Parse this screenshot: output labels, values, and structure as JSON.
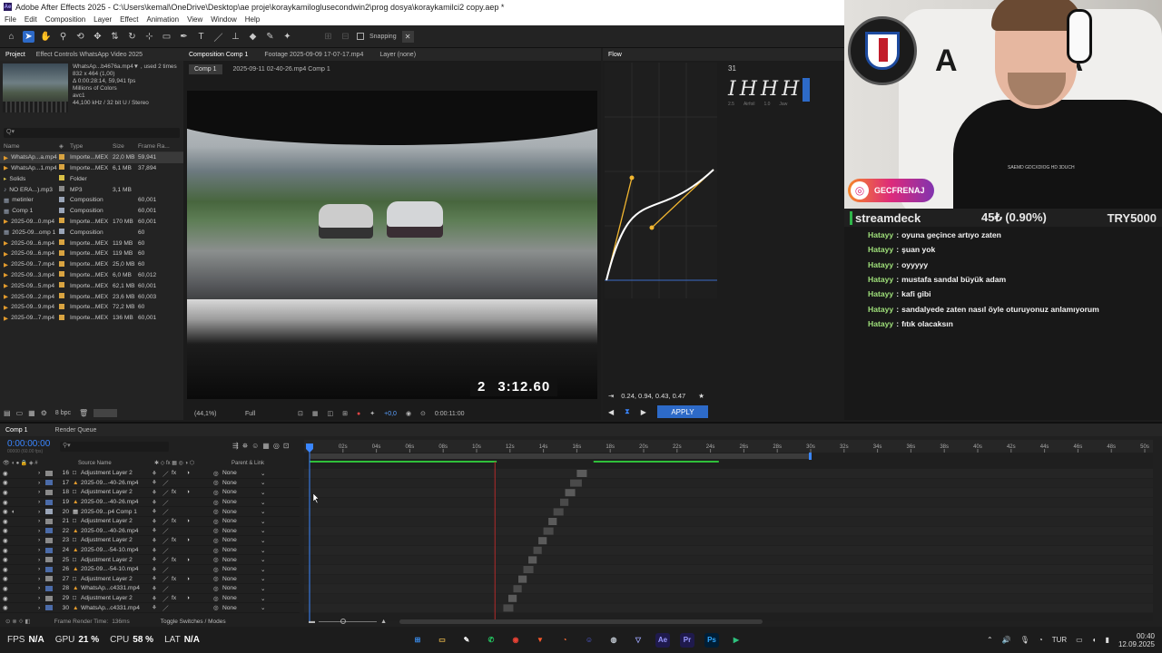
{
  "app": {
    "window_title": "Adobe After Effects 2025 - C:\\Users\\kemal\\OneDrive\\Desktop\\ae proje\\koraykamiloglusecondwin2\\prog dosya\\koraykamilci2 copy.aep *",
    "menu": [
      "File",
      "Edit",
      "Composition",
      "Layer",
      "Effect",
      "Animation",
      "View",
      "Window",
      "Help"
    ],
    "toolbar": {
      "snapping_label": "Snapping"
    }
  },
  "project_panel": {
    "tabs": [
      "Project",
      "Effect Controls WhatsApp Video 2025"
    ],
    "preview_info": [
      "WhatsAp...b4676a.mp4▼ , used 2 times",
      "832 x 464 (1,00)",
      "Δ 0:00:28:14, 59,941 fps",
      "Millions of Colors",
      "avc1",
      "44,100 kHz / 32 bit U / Stereo"
    ],
    "search_placeholder": "Q▾",
    "columns": [
      "Name",
      "Type",
      "Size",
      "Frame Ra..."
    ],
    "items": [
      {
        "name": "WhatsAp...a.mp4",
        "type": "Importe...MEX",
        "size": "22,0 MB",
        "fr": "59,941",
        "color": "#d9a441",
        "icon": "video",
        "selected": true
      },
      {
        "name": "WhatsAp...1.mp4",
        "type": "Importe...MEX",
        "size": "6,1 MB",
        "fr": "37,894",
        "color": "#d9a441",
        "icon": "video"
      },
      {
        "name": "Solids",
        "type": "Folder",
        "size": "",
        "fr": "",
        "color": "#d9c046",
        "icon": "folder"
      },
      {
        "name": "NO ERA...).mp3",
        "type": "MP3",
        "size": "3,1 MB",
        "fr": "",
        "color": "#8a8a8a",
        "icon": "audio"
      },
      {
        "name": "metinler",
        "type": "Composition",
        "size": "",
        "fr": "60,001",
        "color": "#9aa5b8",
        "icon": "comp"
      },
      {
        "name": "Comp 1",
        "type": "Composition",
        "size": "",
        "fr": "60,001",
        "color": "#9aa5b8",
        "icon": "comp"
      },
      {
        "name": "2025-09...0.mp4",
        "type": "Importe...MEX",
        "size": "170 MB",
        "fr": "60,001",
        "color": "#d9a441",
        "icon": "video"
      },
      {
        "name": "2025-09...omp 1",
        "type": "Composition",
        "size": "",
        "fr": "60",
        "color": "#9aa5b8",
        "icon": "comp"
      },
      {
        "name": "2025-09...6.mp4",
        "type": "Importe...MEX",
        "size": "119 MB",
        "fr": "60",
        "color": "#d9a441",
        "icon": "video"
      },
      {
        "name": "2025-09...6.mp4",
        "type": "Importe...MEX",
        "size": "119 MB",
        "fr": "60",
        "color": "#d9a441",
        "icon": "video"
      },
      {
        "name": "2025-09...7.mp4",
        "type": "Importe...MEX",
        "size": "25,0 MB",
        "fr": "60",
        "color": "#d9a441",
        "icon": "video"
      },
      {
        "name": "2025-09...3.mp4",
        "type": "Importe...MEX",
        "size": "6,0 MB",
        "fr": "60,012",
        "color": "#d9a441",
        "icon": "video"
      },
      {
        "name": "2025-09...5.mp4",
        "type": "Importe...MEX",
        "size": "62,1 MB",
        "fr": "60,001",
        "color": "#d9a441",
        "icon": "video"
      },
      {
        "name": "2025-09...2.mp4",
        "type": "Importe...MEX",
        "size": "23,6 MB",
        "fr": "60,003",
        "color": "#d9a441",
        "icon": "video"
      },
      {
        "name": "2025-09...9.mp4",
        "type": "Importe...MEX",
        "size": "72,2 MB",
        "fr": "60",
        "color": "#d9a441",
        "icon": "video"
      },
      {
        "name": "2025-09...7.mp4",
        "type": "Importe...MEX",
        "size": "136 MB",
        "fr": "60,001",
        "color": "#d9a441",
        "icon": "video"
      }
    ],
    "bpc": "8 bpc"
  },
  "comp_panel": {
    "tabs": [
      "Composition Comp 1",
      "Footage 2025-09-09 17-07-17.mp4",
      "Layer (none)"
    ],
    "breadcrumb": [
      "Comp 1",
      "2025-09-11 02-40-26.mp4 Comp 1"
    ],
    "overlay_lap": "2",
    "overlay_time": "3:12.60",
    "zoom": "(44,1%)",
    "resolution": "Full",
    "exposure": "+0,0",
    "timecode": "0:00:11:00"
  },
  "flow_panel": {
    "title": "Flow",
    "values": "0.24, 0.94, 0.43, 0.47",
    "apply_label": "APPLY",
    "preset_number": "31",
    "preset_sublabels": [
      "2.5",
      "Airfoil",
      "1.0",
      "Jaw"
    ]
  },
  "stream": {
    "social_handle": "GECFRENAJ",
    "brand": "streamdeck",
    "price_change": "45₺ (0.90%)",
    "currency_value": "TRY5000",
    "shirt_text": "SAEMD GDCXDIOG HD 3DUCH"
  },
  "chat": {
    "messages": [
      {
        "user": "Hatayy",
        "text": "oyuna geçince artıyo zaten"
      },
      {
        "user": "Hatayy",
        "text": "şuan yok"
      },
      {
        "user": "Hatayy",
        "text": "oyyyyy"
      },
      {
        "user": "Hatayy",
        "text": "mustafa sandal büyük adam"
      },
      {
        "user": "Hatayy",
        "text": "kafi gibi"
      },
      {
        "user": "Hatayy",
        "text": "sandalyede zaten nasıl öyle oturuyonuz anlamıyorum"
      },
      {
        "user": "Hatayy",
        "text": "fıtık olacaksın"
      }
    ]
  },
  "timeline": {
    "tabs": [
      "Comp 1",
      "Render Queue"
    ],
    "current_time": "0:00:00:00",
    "fps_note": "00000 (60.00 fps)",
    "columns": {
      "source_name": "Source Name",
      "parent_link": "Parent & Link"
    },
    "ruler_labels": [
      "0s",
      "02s",
      "04s",
      "06s",
      "08s",
      "10s",
      "12s",
      "14s",
      "16s",
      "18s",
      "20s",
      "22s",
      "24s",
      "26s",
      "28s",
      "30s",
      "32s",
      "34s",
      "36s",
      "38s",
      "40s",
      "42s",
      "44s",
      "46s",
      "48s",
      "50s"
    ],
    "layers": [
      {
        "num": "16",
        "name": "Adjustment Layer 2",
        "parent": "None",
        "kind": "adj",
        "fx": true,
        "bar_start": 16.0,
        "bar_end": 16.6
      },
      {
        "num": "17",
        "name": "2025-09...-40-26.mp4",
        "parent": "None",
        "kind": "video",
        "fx": false,
        "bar_start": 15.6,
        "bar_end": 16.3
      },
      {
        "num": "18",
        "name": "Adjustment Layer 2",
        "parent": "None",
        "kind": "adj",
        "fx": true,
        "bar_start": 15.3,
        "bar_end": 15.9
      },
      {
        "num": "19",
        "name": "2025-09...-40-26.mp4",
        "parent": "None",
        "kind": "video",
        "fx": false,
        "bar_start": 15.0,
        "bar_end": 15.5
      },
      {
        "num": "20",
        "name": "2025-09...p4 Comp 1",
        "parent": "None",
        "kind": "comp",
        "fx": false,
        "bar_start": 14.6,
        "bar_end": 15.2
      },
      {
        "num": "21",
        "name": "Adjustment Layer 2",
        "parent": "None",
        "kind": "adj",
        "fx": true,
        "bar_start": 14.3,
        "bar_end": 14.8
      },
      {
        "num": "22",
        "name": "2025-09...-40-26.mp4",
        "parent": "None",
        "kind": "video",
        "fx": false,
        "bar_start": 14.0,
        "bar_end": 14.6
      },
      {
        "num": "23",
        "name": "Adjustment Layer 2",
        "parent": "None",
        "kind": "adj",
        "fx": true,
        "bar_start": 13.7,
        "bar_end": 14.2
      },
      {
        "num": "24",
        "name": "2025-09...-54-10.mp4",
        "parent": "None",
        "kind": "video",
        "fx": false,
        "bar_start": 13.4,
        "bar_end": 13.9
      },
      {
        "num": "25",
        "name": "Adjustment Layer 2",
        "parent": "None",
        "kind": "adj",
        "fx": true,
        "bar_start": 13.1,
        "bar_end": 13.6
      },
      {
        "num": "26",
        "name": "2025-09...-54-10.mp4",
        "parent": "None",
        "kind": "video",
        "fx": false,
        "bar_start": 12.8,
        "bar_end": 13.4
      },
      {
        "num": "27",
        "name": "Adjustment Layer 2",
        "parent": "None",
        "kind": "adj",
        "fx": true,
        "bar_start": 12.5,
        "bar_end": 13.0
      },
      {
        "num": "28",
        "name": "WhatsAp...c4331.mp4",
        "parent": "None",
        "kind": "video",
        "fx": false,
        "bar_start": 12.2,
        "bar_end": 12.7
      },
      {
        "num": "29",
        "name": "Adjustment Layer 2",
        "parent": "None",
        "kind": "adj",
        "fx": true,
        "bar_start": 11.9,
        "bar_end": 12.4
      },
      {
        "num": "30",
        "name": "WhatsAp...c4331.mp4",
        "parent": "None",
        "kind": "video",
        "fx": false,
        "bar_start": 11.6,
        "bar_end": 12.2
      }
    ],
    "work_area_end_s": 30.0,
    "playhead_s": 0,
    "red_marker_s": 11.1,
    "frame_render_time": "Frame Render Time:",
    "frame_render_value": "136ms",
    "toggle_label": "Toggle Switches / Modes"
  },
  "taskbar": {
    "stats": [
      {
        "label": "FPS",
        "value": "N/A"
      },
      {
        "label": "GPU",
        "value": "21 %"
      },
      {
        "label": "CPU",
        "value": "58 %"
      },
      {
        "label": "LAT",
        "value": "N/A"
      }
    ],
    "apps": [
      {
        "name": "windows",
        "color": "#3a8ef0",
        "glyph": "⊞"
      },
      {
        "name": "explorer",
        "color": "#e6b54a",
        "glyph": "▭"
      },
      {
        "name": "notepad",
        "color": "#ffffff",
        "glyph": "✎"
      },
      {
        "name": "whatsapp",
        "color": "#25d366",
        "glyph": "✆"
      },
      {
        "name": "chrome",
        "color": "#e94235",
        "glyph": "◉"
      },
      {
        "name": "brave",
        "color": "#ff5a2b",
        "glyph": "▼"
      },
      {
        "name": "firefox",
        "color": "#ff7139",
        "glyph": "◔"
      },
      {
        "name": "discord",
        "color": "#5865f2",
        "glyph": "☺"
      },
      {
        "name": "steam",
        "color": "#c0c7d0",
        "glyph": "◍"
      },
      {
        "name": "vpn",
        "color": "#9fa8ff",
        "glyph": "▽"
      },
      {
        "name": "after-effects",
        "color": "#9999ff",
        "glyph": "Ae"
      },
      {
        "name": "premiere",
        "color": "#9999ff",
        "glyph": "Pr"
      },
      {
        "name": "photoshop",
        "color": "#31a8ff",
        "glyph": "Ps"
      },
      {
        "name": "media-player",
        "color": "#2ec27e",
        "glyph": "▶"
      }
    ],
    "language": "TUR",
    "time": "00:40",
    "date": "12.09.2025"
  },
  "colors": {
    "accent": "#2d6ac8",
    "apply": "#2d6ac8",
    "chat_user": "#9fe07a",
    "curve": "#f2b630"
  }
}
